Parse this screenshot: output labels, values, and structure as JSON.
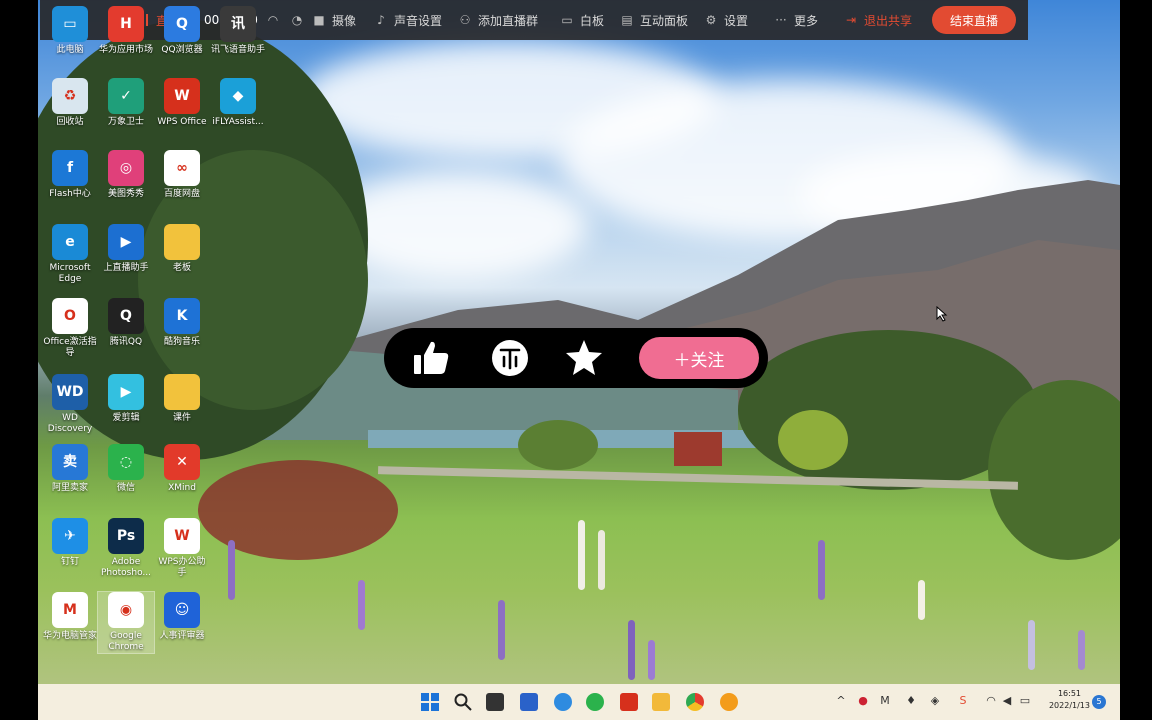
{
  "toolbar": {
    "status": "直播中",
    "timer": "00:00:00",
    "camera": "摄像",
    "sound_settings": "声音设置",
    "add_group": "添加直播群",
    "whiteboard": "白板",
    "interact_panel": "互动面板",
    "settings": "设置",
    "more": "更多",
    "exit_share": "退出共享",
    "end_live": "结束直播",
    "accent": "#e24b32"
  },
  "desktop_icons": [
    {
      "label": "此电脑"
    },
    {
      "label": "华为应用市场"
    },
    {
      "label": "QQ浏览器"
    },
    {
      "label": "讯飞语音助手"
    },
    {
      "label": "回收站"
    },
    {
      "label": "万象卫士"
    },
    {
      "label": "WPS Office"
    },
    {
      "label": "iFLYAssist..."
    },
    {
      "label": "Flash中心"
    },
    {
      "label": "美图秀秀"
    },
    {
      "label": "百度网盘"
    },
    {
      "label": "Microsoft Edge"
    },
    {
      "label": "上直播助手"
    },
    {
      "label": "老板"
    },
    {
      "label": "Office激活指导"
    },
    {
      "label": "腾讯QQ"
    },
    {
      "label": "酷狗音乐"
    },
    {
      "label": "WD Discovery"
    },
    {
      "label": "爱剪辑"
    },
    {
      "label": "课件"
    },
    {
      "label": "阿里卖家"
    },
    {
      "label": "微信"
    },
    {
      "label": "XMind"
    },
    {
      "label": "钉钉"
    },
    {
      "label": "Adobe Photosho..."
    },
    {
      "label": "WPS办公助手"
    },
    {
      "label": "华为电脑管家"
    },
    {
      "label": "Google Chrome"
    },
    {
      "label": "人事评审器"
    }
  ],
  "overlay": {
    "follow_label": "＋关注",
    "follow_color": "#f06d92"
  },
  "taskbar": {
    "time": "16:51",
    "date": "2022/1/13",
    "notification_count": "5"
  }
}
